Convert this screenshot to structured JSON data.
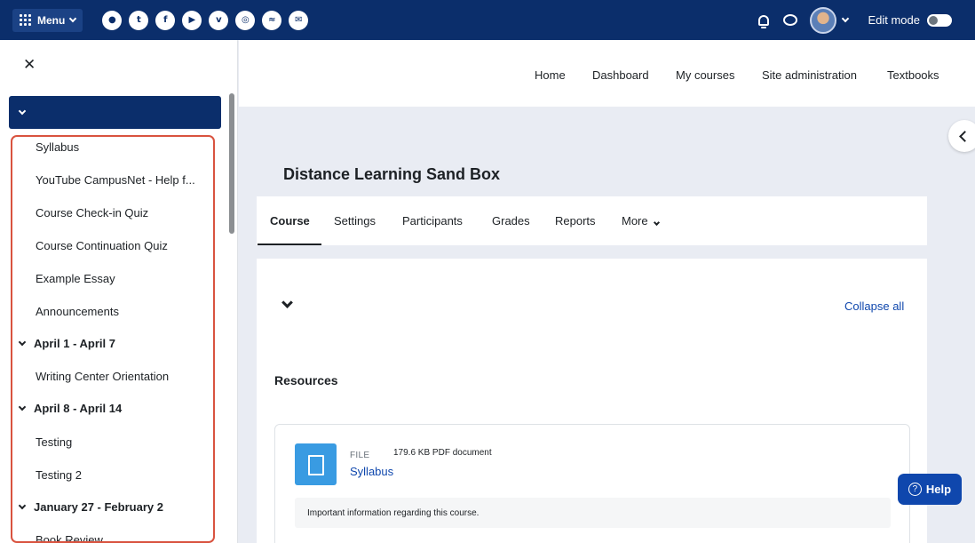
{
  "topbar": {
    "menu_label": "Menu",
    "social_icons": [
      {
        "name": "globe-icon",
        "glyph": "●"
      },
      {
        "name": "twitter-icon",
        "glyph": "t"
      },
      {
        "name": "facebook-icon",
        "glyph": "f"
      },
      {
        "name": "youtube-icon",
        "glyph": "▶"
      },
      {
        "name": "vimeo-icon",
        "glyph": "v"
      },
      {
        "name": "instagram-icon",
        "glyph": "◎"
      },
      {
        "name": "rss-icon",
        "glyph": "≈"
      },
      {
        "name": "mail-icon",
        "glyph": "✉"
      }
    ],
    "edit_mode_label": "Edit mode"
  },
  "sidebar": {
    "close_glyph": "✕",
    "items": [
      {
        "label": "Syllabus",
        "type": "item"
      },
      {
        "label": "YouTube CampusNet - Help f...",
        "type": "item"
      },
      {
        "label": "Course Check-in Quiz",
        "type": "item"
      },
      {
        "label": "Course Continuation Quiz",
        "type": "item"
      },
      {
        "label": "Example Essay",
        "type": "item"
      },
      {
        "label": "Announcements",
        "type": "item"
      },
      {
        "label": "April 1 - April 7",
        "type": "section"
      },
      {
        "label": "Writing Center Orientation",
        "type": "item"
      },
      {
        "label": "April 8 - April 14",
        "type": "section"
      },
      {
        "label": "Testing",
        "type": "item"
      },
      {
        "label": "Testing 2",
        "type": "item"
      },
      {
        "label": "January 27 - February 2",
        "type": "section"
      },
      {
        "label": "Book Review",
        "type": "item"
      }
    ]
  },
  "nav": {
    "links": [
      "Home",
      "Dashboard",
      "My courses",
      "Site administration",
      "Textbooks"
    ]
  },
  "page": {
    "title": "Distance Learning Sand Box"
  },
  "tabs": {
    "course": "Course",
    "settings": "Settings",
    "participants": "Participants",
    "grades": "Grades",
    "reports": "Reports",
    "more": "More"
  },
  "content": {
    "collapse_all": "Collapse all",
    "resources_heading": "Resources",
    "activity": {
      "type_label": "FILE",
      "meta": "179.6 KB PDF document",
      "name": "Syllabus",
      "description": "Important information regarding this course."
    }
  },
  "help": {
    "label": "Help",
    "glyph": "?"
  },
  "colors": {
    "header_bg": "#0b2e6b",
    "link": "#0f47ad",
    "highlight_border": "#d9533f",
    "file_icon": "#399be2"
  }
}
